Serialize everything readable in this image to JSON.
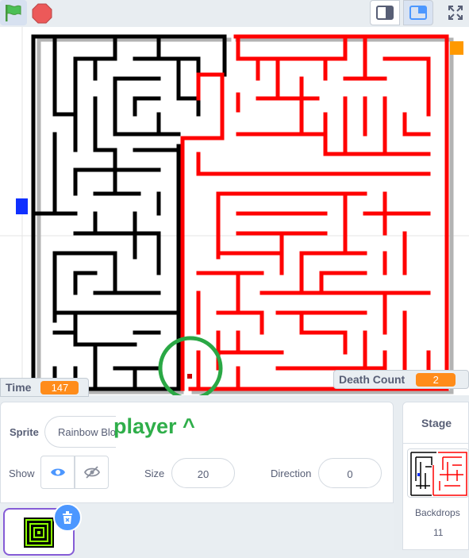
{
  "stage_monitors": {
    "time_label": "Time",
    "time_value": "147",
    "death_label": "Death Count",
    "death_value": "2"
  },
  "annotation_text": "player ^",
  "sprite_info": {
    "sprite_label": "Sprite",
    "sprite_name": "Rainbow Blo",
    "show_label": "Show",
    "size_label": "Size",
    "size_value": "20",
    "direction_label": "Direction",
    "direction_value": "0"
  },
  "stage_panel": {
    "title": "Stage",
    "backdrops_label": "Backdrops",
    "backdrops_count": "11"
  },
  "icons": {
    "green_flag": "green-flag-icon",
    "stop": "stop-sign-icon",
    "small_stage": "small-stage-icon",
    "normal_stage": "normal-stage-icon",
    "fullscreen": "fullscreen-icon",
    "eye": "eye-icon",
    "eye_off": "eye-off-icon",
    "trash": "trash-icon"
  },
  "colors": {
    "accent_blue": "#4c97ff",
    "monitor_orange": "#ff8c1a",
    "annotation_green": "#2fae4a",
    "maze_red": "#ff0000",
    "maze_black": "#000000",
    "selected_purple": "#855cd6"
  }
}
